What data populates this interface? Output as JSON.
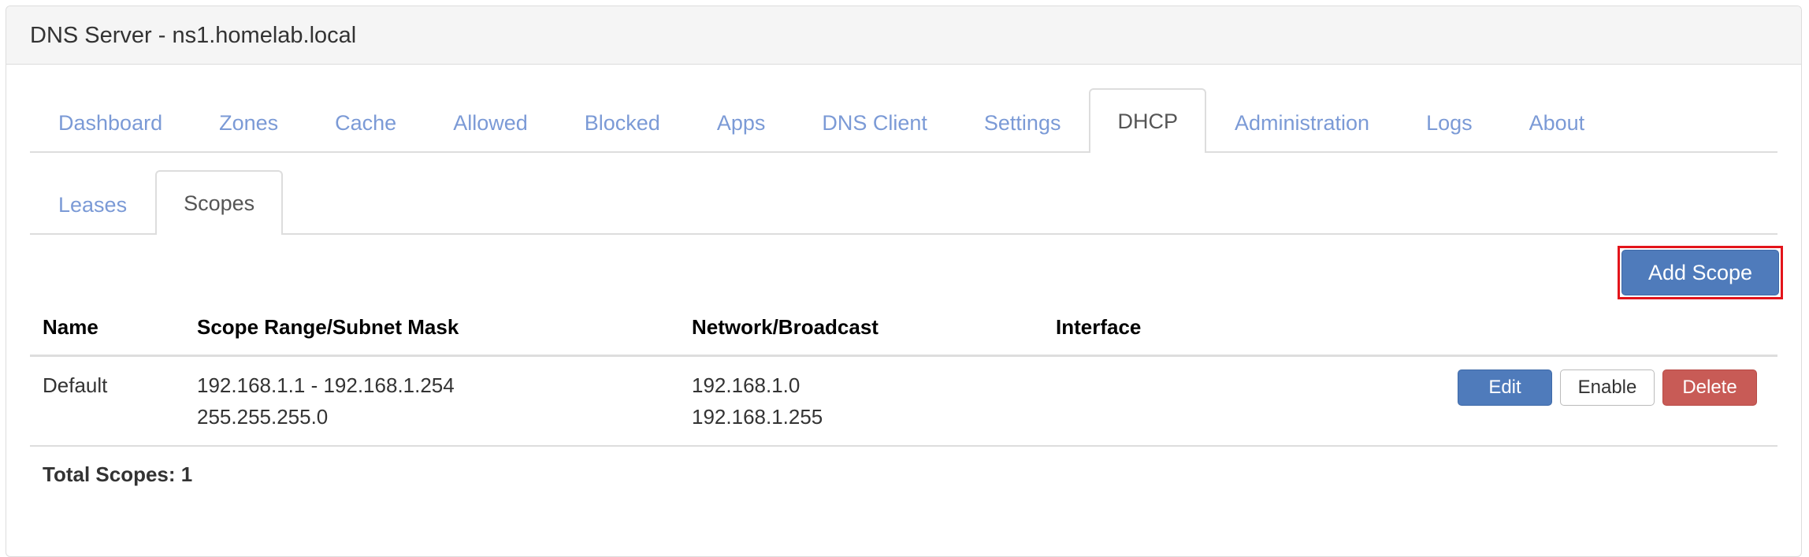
{
  "window": {
    "title": "DNS Server - ns1.homelab.local"
  },
  "main_tabs": [
    {
      "label": "Dashboard",
      "active": false
    },
    {
      "label": "Zones",
      "active": false
    },
    {
      "label": "Cache",
      "active": false
    },
    {
      "label": "Allowed",
      "active": false
    },
    {
      "label": "Blocked",
      "active": false
    },
    {
      "label": "Apps",
      "active": false
    },
    {
      "label": "DNS Client",
      "active": false
    },
    {
      "label": "Settings",
      "active": false
    },
    {
      "label": "DHCP",
      "active": true
    },
    {
      "label": "Administration",
      "active": false
    },
    {
      "label": "Logs",
      "active": false
    },
    {
      "label": "About",
      "active": false
    }
  ],
  "sub_tabs": [
    {
      "label": "Leases",
      "active": false
    },
    {
      "label": "Scopes",
      "active": true
    }
  ],
  "toolbar": {
    "add_scope_label": "Add Scope",
    "highlight_color": "#e3141b"
  },
  "table": {
    "columns": [
      "Name",
      "Scope Range/Subnet Mask",
      "Network/Broadcast",
      "Interface",
      ""
    ],
    "rows": [
      {
        "name": "Default",
        "range": "192.168.1.1 - 192.168.1.254",
        "subnet_mask": "255.255.255.0",
        "network": "192.168.1.0",
        "broadcast": "192.168.1.255",
        "interface": "",
        "actions": {
          "edit": "Edit",
          "enable": "Enable",
          "delete": "Delete"
        }
      }
    ]
  },
  "footer": {
    "total_label": "Total Scopes: 1"
  },
  "colors": {
    "link": "#7b9ad6",
    "primary": "#4f7bbb",
    "danger": "#c85b56"
  }
}
